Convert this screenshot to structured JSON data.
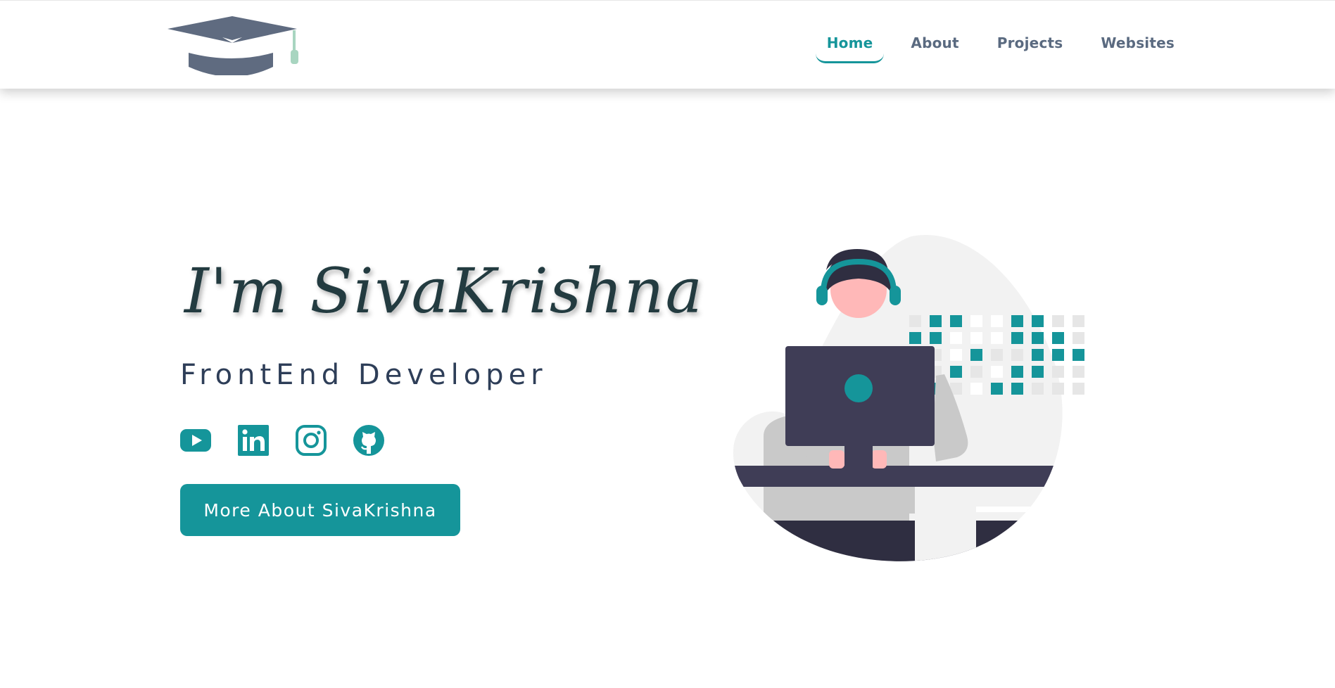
{
  "nav": {
    "items": [
      {
        "label": "Home",
        "active": true
      },
      {
        "label": "About",
        "active": false
      },
      {
        "label": "Projects",
        "active": false
      },
      {
        "label": "Websites",
        "active": false
      }
    ]
  },
  "hero": {
    "name": "I'm SivaKrishna",
    "role": "FrontEnd Developer",
    "cta_label": "More About SivaKrishna"
  },
  "socials": [
    {
      "icon": "youtube-icon"
    },
    {
      "icon": "linkedin-icon"
    },
    {
      "icon": "instagram-icon"
    },
    {
      "icon": "github-icon"
    }
  ],
  "colors": {
    "accent": "#15959a",
    "heading": "#233b40",
    "nav_text": "#5a6a80",
    "role_text": "#2e3e58",
    "logo": "#5f6b80"
  }
}
